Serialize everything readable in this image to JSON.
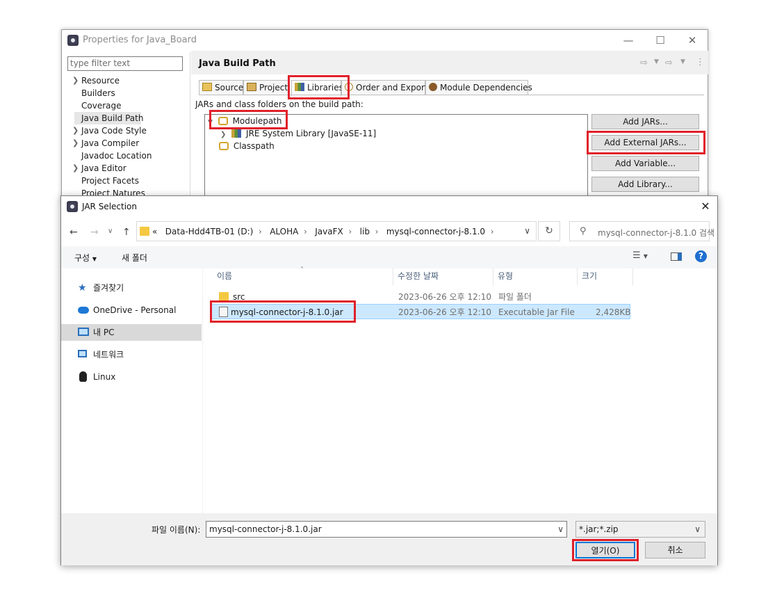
{
  "properties_window": {
    "title": "Properties for Java_Board",
    "filter_placeholder": "type filter text",
    "tree": [
      {
        "label": "Resource",
        "expandable": true
      },
      {
        "label": "Builders",
        "expandable": false
      },
      {
        "label": "Coverage",
        "expandable": false
      },
      {
        "label": "Java Build Path",
        "expandable": false,
        "selected": true
      },
      {
        "label": "Java Code Style",
        "expandable": true
      },
      {
        "label": "Java Compiler",
        "expandable": true
      },
      {
        "label": "Javadoc Location",
        "expandable": false
      },
      {
        "label": "Java Editor",
        "expandable": true
      },
      {
        "label": "Project Facets",
        "expandable": false
      },
      {
        "label": "Project Natures",
        "expandable": false
      }
    ],
    "section_title": "Java Build Path",
    "tabs": [
      "Source",
      "Projects",
      "Libraries",
      "Order and Export",
      "Module Dependencies"
    ],
    "tab_project_visible": "Project",
    "active_tab": "Libraries",
    "caption": "JARs and class folders on the build path:",
    "library_tree": {
      "modulepath": "Modulepath",
      "jre": "JRE System Library [JavaSE-11]",
      "classpath": "Classpath"
    },
    "buttons": {
      "add_jars": "Add JARs...",
      "add_external_jars": "Add External JARs...",
      "add_variable": "Add Variable...",
      "add_library": "Add Library..."
    }
  },
  "jar_dialog": {
    "title": "JAR Selection",
    "breadcrumb": [
      "«",
      "Data-Hdd4TB-01 (D:)",
      "ALOHA",
      "JavaFX",
      "lib",
      "mysql-connector-j-8.1.0"
    ],
    "search_placeholder": "mysql-connector-j-8.1.0 검색",
    "toolbar": {
      "organize": "구성",
      "new_folder": "새 폴더"
    },
    "nav_pane": [
      {
        "label": "즐겨찾기",
        "icon": "star-icon"
      },
      {
        "label": "OneDrive - Personal",
        "icon": "cloud-icon"
      },
      {
        "label": "내 PC",
        "icon": "pc-icon",
        "selected": true
      },
      {
        "label": "네트워크",
        "icon": "network-icon"
      },
      {
        "label": "Linux",
        "icon": "linux-icon"
      }
    ],
    "columns": [
      "이름",
      "수정한 날짜",
      "유형",
      "크기"
    ],
    "files": [
      {
        "name": "src",
        "date": "2023-06-26 오후 12:10",
        "type": "파일 폴더",
        "size": ""
      },
      {
        "name": "mysql-connector-j-8.1.0.jar",
        "date": "2023-06-26 오후 12:10",
        "type": "Executable Jar File",
        "size": "2,428KB",
        "selected": true
      }
    ],
    "file_name_label": "파일 이름(N):",
    "file_name_value": "mysql-connector-j-8.1.0.jar",
    "file_type": "*.jar;*.zip",
    "open_button": "열기(O)",
    "cancel_button": "취소"
  }
}
